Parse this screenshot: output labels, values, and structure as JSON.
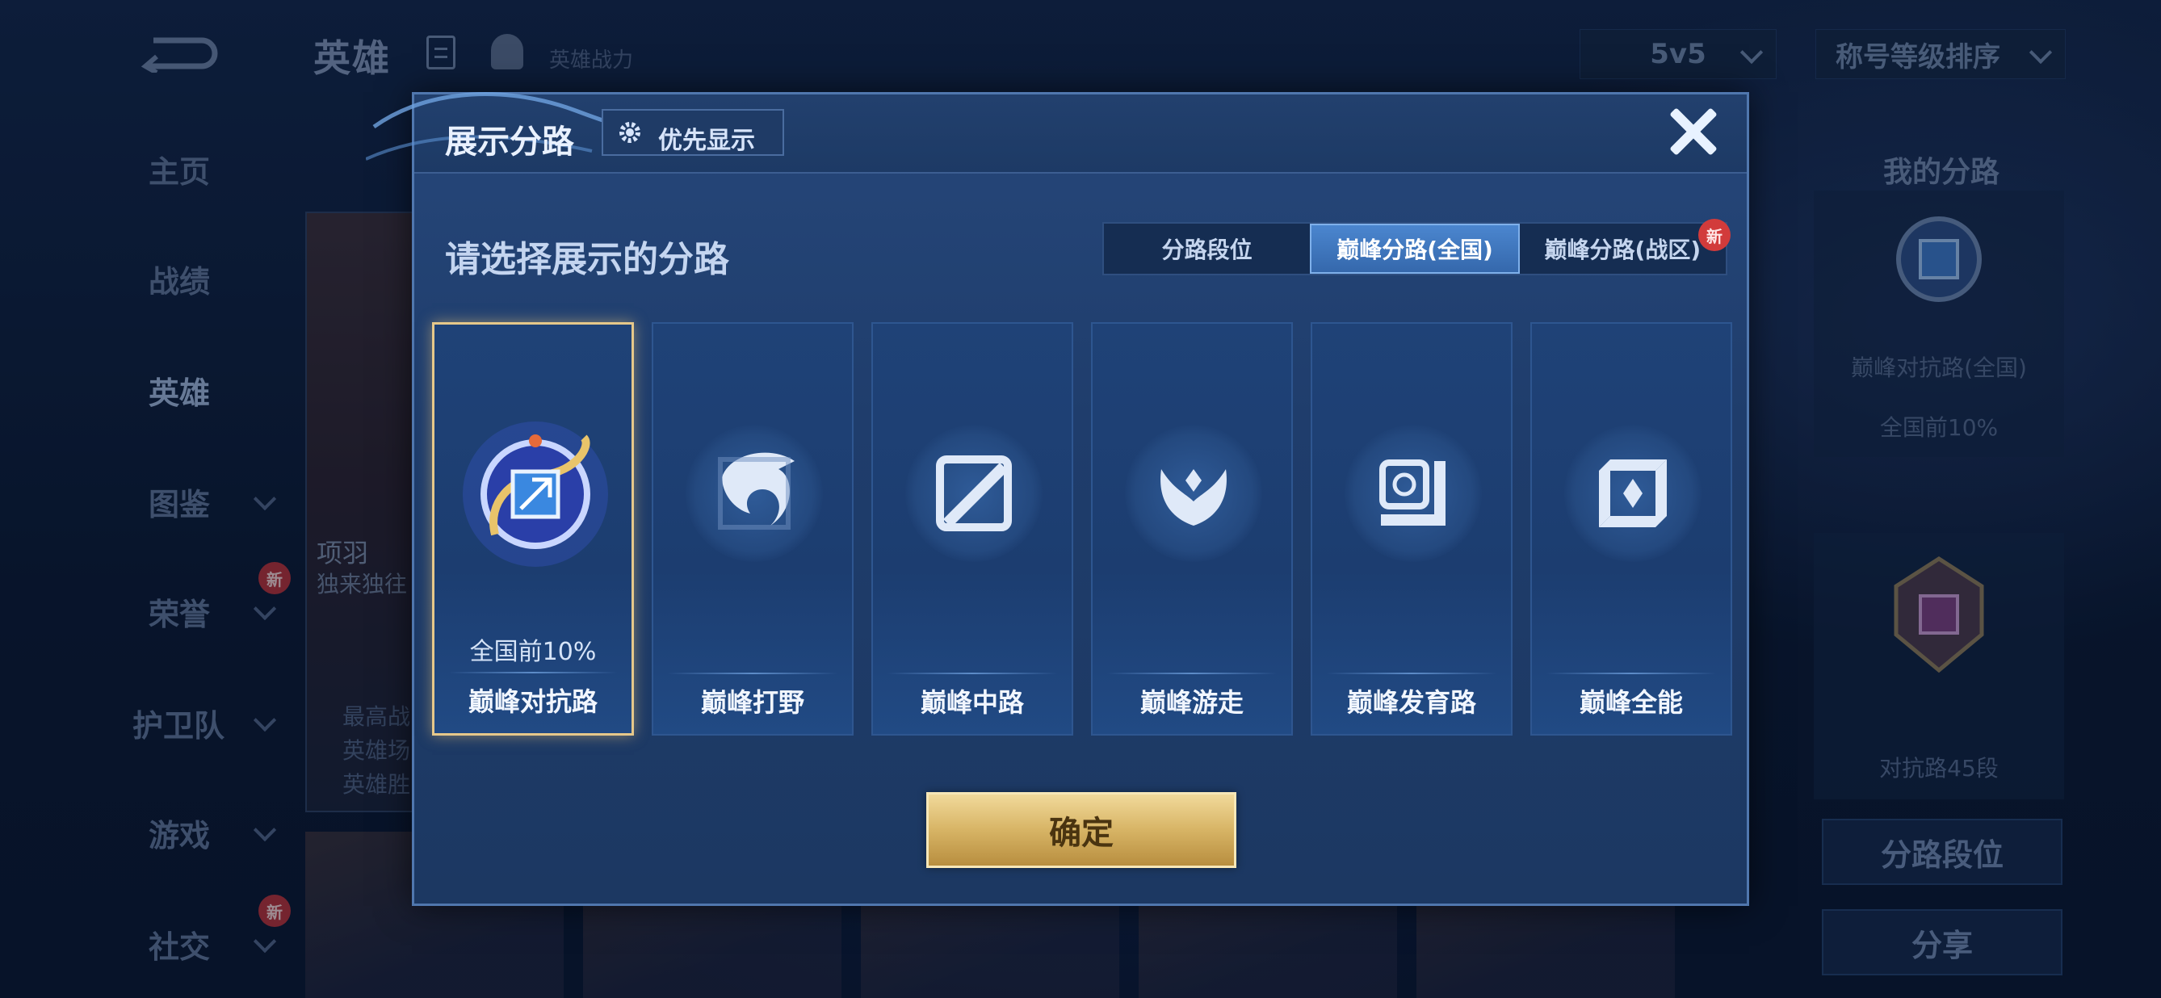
{
  "top_bar": {
    "title": "英雄",
    "power_label": "英雄战力",
    "mode_select": "5v5",
    "sort_select": "称号等级排序"
  },
  "sidebar": {
    "items": [
      {
        "label": "主页",
        "new": false
      },
      {
        "label": "战绩",
        "new": false
      },
      {
        "label": "英雄",
        "new": false
      },
      {
        "label": "图鉴",
        "new": false
      },
      {
        "label": "荣誉",
        "new": true
      },
      {
        "label": "护卫队",
        "new": false
      },
      {
        "label": "游戏",
        "new": false
      },
      {
        "label": "社交",
        "new": true
      }
    ],
    "new_badge": "新"
  },
  "hero_card": {
    "name": "项羽",
    "subtitle": "独来独往",
    "stats": [
      "最高战",
      "英雄场",
      "英雄胜"
    ]
  },
  "right_panel": {
    "title": "我的分路",
    "lane_name": "巅峰对抗路(全国)",
    "lane_rank": "全国前10%",
    "lane_level": "对抗路45段",
    "btn_lane_rank": "分路段位",
    "btn_share": "分享"
  },
  "modal": {
    "title": "展示分路",
    "priority_button": "优先显示",
    "subtitle": "请选择展示的分路",
    "tabs": [
      {
        "label": "分路段位",
        "active": false
      },
      {
        "label": "巅峰分路(全国)",
        "active": true
      },
      {
        "label": "巅峰分路(战区)",
        "active": false,
        "new": "新"
      }
    ],
    "lanes": [
      {
        "label": "巅峰对抗路",
        "rank": "全国前10%",
        "selected": true,
        "icon": "clash-lane-icon"
      },
      {
        "label": "巅峰打野",
        "rank": "",
        "selected": false,
        "icon": "jungle-dragon-icon"
      },
      {
        "label": "巅峰中路",
        "rank": "",
        "selected": false,
        "icon": "mid-lane-icon"
      },
      {
        "label": "巅峰游走",
        "rank": "",
        "selected": false,
        "icon": "roam-wings-icon"
      },
      {
        "label": "巅峰发育路",
        "rank": "",
        "selected": false,
        "icon": "farm-lane-icon"
      },
      {
        "label": "巅峰全能",
        "rank": "",
        "selected": false,
        "icon": "all-round-icon"
      }
    ],
    "confirm_button": "确定"
  },
  "colors": {
    "modal_bg": "#1f3d6c",
    "selected_border": "#e6c88a",
    "active_tab": "#3f78c0",
    "confirm_gold": "#d7b465",
    "new_badge": "#d23b3b"
  }
}
